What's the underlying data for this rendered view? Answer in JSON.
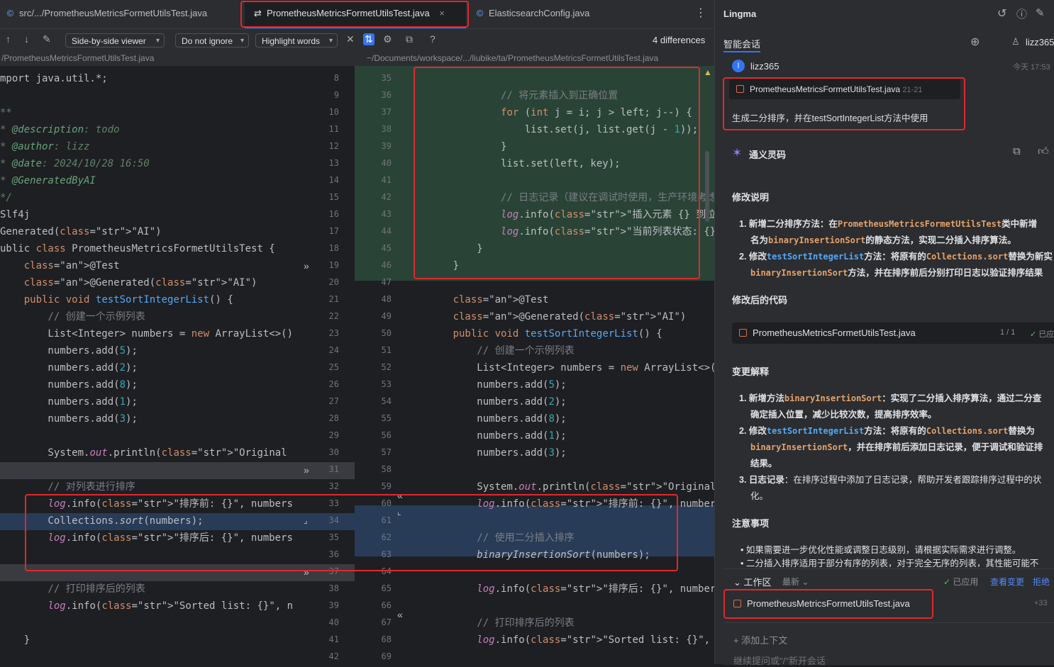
{
  "tabs": [
    {
      "label": "src/.../PrometheusMetricsFormetUtilsTest.java"
    },
    {
      "label": "PrometheusMetricsFormetUtilsTest.java"
    },
    {
      "label": "ElasticsearchConfig.java"
    }
  ],
  "toolbar": {
    "viewer": "Side-by-side viewer",
    "ignore": "Do not ignore",
    "highlight": "Highlight words",
    "differences": "4 differences"
  },
  "paths": {
    "left": "/PrometheusMetricsFormetUtilsTest.java",
    "right": "~/Documents/workspace/.../liubike/ta/PrometheusMetricsFormetUtilsTest.java"
  },
  "left_code": [
    "mport java.util.*;",
    "",
    "**",
    "* @description: todo",
    "* @author: lizz",
    "* @date: 2024/10/28 16:50",
    "* @GeneratedByAI",
    "*/",
    "Slf4j",
    "Generated(\"AI\")",
    "ublic class PrometheusMetricsFormetUtilsTest {",
    "    @Test",
    "    @Generated(\"AI\")",
    "    public void testSortIntegerList() {",
    "        // 创建一个示例列表",
    "        List<Integer> numbers = new ArrayList<>();",
    "        numbers.add(5);",
    "        numbers.add(2);",
    "        numbers.add(8);",
    "        numbers.add(1);",
    "        numbers.add(3);",
    "",
    "        System.out.println(\"Original list: \" + num",
    "",
    "        // 对列表进行排序",
    "        log.info(\"排序前: {}\", numbers);",
    "        Collections.sort(numbers);",
    "        log.info(\"排序后: {}\", numbers);",
    "",
    "",
    "        // 打印排序后的列表",
    "        log.info(\"Sorted list: {}\", numbers); // 输",
    "",
    "    }"
  ],
  "left_line_numbers": [
    "8",
    "9",
    "10",
    "11",
    "12",
    "13",
    "14",
    "15",
    "16",
    "17",
    "18",
    "19",
    "20",
    "21",
    "22",
    "23",
    "24",
    "25",
    "26",
    "27",
    "28",
    "29",
    "30",
    "31",
    "32",
    "33",
    "34",
    "35",
    "36",
    "37",
    "38",
    "39",
    "40",
    "41",
    "42"
  ],
  "right_line_numbers": [
    "35",
    "36",
    "37",
    "38",
    "39",
    "40",
    "41",
    "42",
    "43",
    "44",
    "45",
    "46",
    "47",
    "48",
    "49",
    "50",
    "51",
    "52",
    "53",
    "54",
    "55",
    "56",
    "57",
    "58",
    "59",
    "60",
    "61",
    "62",
    "63",
    "64",
    "65",
    "66",
    "67",
    "68",
    "69"
  ],
  "right_code": [
    "",
    "            // 将元素插入到正确位置",
    "            for (int j = i; j > left; j--) {",
    "                list.set(j, list.get(j - 1));",
    "            }",
    "            list.set(left, key);",
    "",
    "            // 日志记录（建议在调试时使用，生产环境考虑移",
    "            log.info(\"插入元素 {} 到位置 {}\", key, le",
    "            log.info(\"当前列表状态: {}\", list);",
    "        }",
    "    }",
    "",
    "    @Test",
    "    @Generated(\"AI\")",
    "    public void testSortIntegerList() {",
    "        // 创建一个示例列表",
    "        List<Integer> numbers = new ArrayList<>();",
    "        numbers.add(5);",
    "        numbers.add(2);",
    "        numbers.add(8);",
    "        numbers.add(1);",
    "        numbers.add(3);",
    "",
    "        System.out.println(\"Original list: \" + numbe",
    "        log.info(\"排序前: {}\", numbers);",
    "",
    "        // 使用二分插入排序",
    "        binaryInsertionSort(numbers);",
    "",
    "        log.info(\"排序后: {}\", numbers);",
    "",
    "        // 打印排序后的列表",
    "        log.info(\"Sorted list: {}\", numbers); // 输出",
    ""
  ],
  "panel": {
    "title": "Lingma",
    "tab": "智能会话",
    "user": "lizz365",
    "user_initial": "l",
    "time": "今天 17:53",
    "ref_file": "PrometheusMetricsFormetUtilsTest.java",
    "ref_range": "21-21",
    "prompt": "生成二分排序，并在testSortIntegerList方法中使用",
    "assistant": "通义灵码",
    "sec1": "修改说明",
    "item1_a": "新增二分排序方法：在",
    "item1_code": "PrometheusMetricsFormetUtilsTest",
    "item1_b": "类中新增",
    "item1_c": "名为",
    "item1_code2": "binaryInsertionSort",
    "item1_d": "的静态方法，实现二分插入排序算法。",
    "item2_a": "修改",
    "item2_code": "testSortIntegerList",
    "item2_b": "方法：将原有的",
    "item2_code2": "Collections.sort",
    "item2_c": "替换为新实",
    "item2_code3": "binaryInsertionSort",
    "item2_d": "方法，并在排序前后分别打印日志以验证排序结果",
    "sec2": "修改后的代码",
    "code_file": "PrometheusMetricsFormetUtilsTest.java",
    "code_count": "1 / 1",
    "code_status": "已应",
    "sec3": "变更解释",
    "c1_a": "新增方法",
    "c1_code": "binaryInsertionSort",
    "c1_b": "：实现了二分插入排序算法，通过二分查",
    "c1_c": "确定插入位置，减少比较次数，提高排序效率。",
    "c2_a": "修改",
    "c2_code": "testSortIntegerList",
    "c2_b": "方法：将原有的",
    "c2_code2": "Collections.sort",
    "c2_c": "替换为",
    "c2_code3": "binaryInsertionSort",
    "c2_d": "，并在排序前后添加日志记录，便于调试和验证排",
    "c2_e": "结果。",
    "c3_a": "日志记录",
    "c3_b": "：在排序过程中添加了日志记录，帮助开发者跟踪排序过程中的状",
    "c3_c": "化。",
    "sec4": "注意事项",
    "note1": "如果需要进一步优化性能或调整日志级别，请根据实际需求进行调整。",
    "note2": "二分插入排序适用于部分有序的列表，对于完全无序的列表，其性能可能不",
    "workspace": "工作区",
    "latest": "最新",
    "applied": "已应用",
    "view_changes": "查看变更",
    "reject": "拒绝",
    "ws_file": "PrometheusMetricsFormetUtilsTest.java",
    "ws_count": "+33",
    "add_context": "添加上下文",
    "input_placeholder": "继续提问或\"/\"新开会话"
  }
}
